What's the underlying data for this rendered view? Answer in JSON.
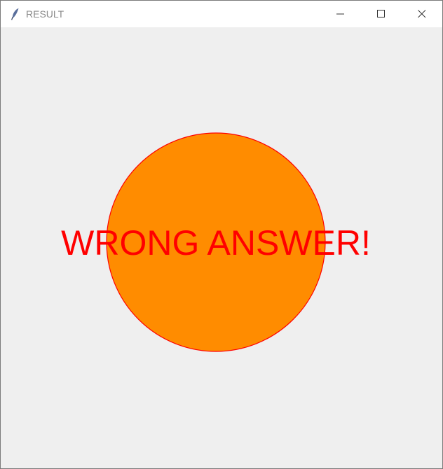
{
  "window": {
    "title": "RESULT"
  },
  "icons": {
    "app": "feather-icon",
    "minimize": "minimize-icon",
    "maximize": "maximize-icon",
    "close": "close-icon"
  },
  "result": {
    "message": "WRONG ANSWER!",
    "text_color": "#ff0000",
    "circle_fill": "#ff8c00",
    "circle_outline": "#ff0000"
  },
  "colors": {
    "titlebar": "#ffffff",
    "canvas_background": "#efefef"
  }
}
